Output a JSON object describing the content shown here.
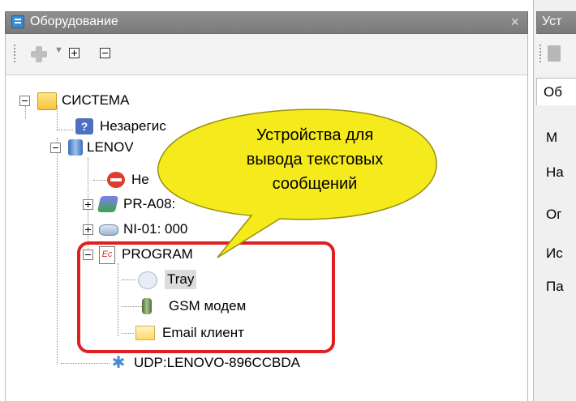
{
  "left_panel": {
    "title": "Оборудование",
    "close": "×"
  },
  "toolbar": {
    "add_icon": "plus-icon",
    "arrow": "▼"
  },
  "tree": {
    "root": "СИСТЕМА",
    "unregistered": "Незарегис",
    "lenovo": "LENOV",
    "item_stop": "Не",
    "printer": "PR-A08:",
    "ni": "NI-01: 000",
    "program": "PROGRAM",
    "tray": "Tray",
    "gsm": "GSM модем",
    "email": "Email клиент",
    "udp": "UDP:LENOVO-896CCBDA"
  },
  "callout": {
    "line1": "Устройства для",
    "line2": "вывода текстовых",
    "line3": "сообщений"
  },
  "right_panel": {
    "title": "Уст",
    "tab": "Об",
    "label1": "М",
    "label2": "На",
    "label3": "Ог",
    "label4": "Ис",
    "label5": "Па"
  },
  "colors": {
    "callout_fill": "#f5ea1c",
    "highlight": "#e02020",
    "title_bar": "#848484"
  }
}
